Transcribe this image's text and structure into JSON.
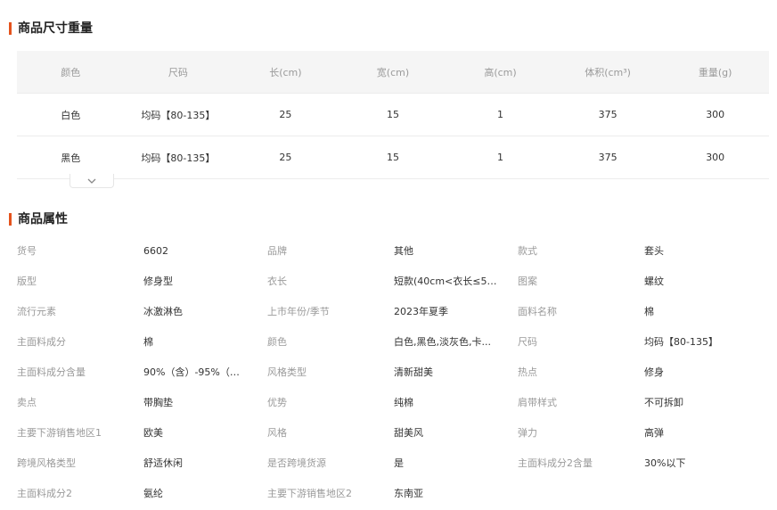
{
  "size_section": {
    "title": "商品尺寸重量",
    "headers": [
      "颜色",
      "尺码",
      "长(cm)",
      "宽(cm)",
      "高(cm)",
      "体积(cm³)",
      "重量(g)"
    ],
    "rows": [
      [
        "白色",
        "均码【80-135】",
        "25",
        "15",
        "1",
        "375",
        "300"
      ],
      [
        "黑色",
        "均码【80-135】",
        "25",
        "15",
        "1",
        "375",
        "300"
      ]
    ],
    "expand_icon": "chevron-down-icon"
  },
  "attr_section": {
    "title": "商品属性",
    "items": [
      {
        "label": "货号",
        "value": "6602"
      },
      {
        "label": "品牌",
        "value": "其他"
      },
      {
        "label": "款式",
        "value": "套头"
      },
      {
        "label": "版型",
        "value": "修身型"
      },
      {
        "label": "衣长",
        "value": "短款(40cm<衣长≤50..."
      },
      {
        "label": "图案",
        "value": "螺纹"
      },
      {
        "label": "流行元素",
        "value": "冰激淋色"
      },
      {
        "label": "上市年份/季节",
        "value": "2023年夏季"
      },
      {
        "label": "面料名称",
        "value": "棉"
      },
      {
        "label": "主面料成分",
        "value": "棉"
      },
      {
        "label": "颜色",
        "value": "白色,黑色,淡灰色,卡..."
      },
      {
        "label": "尺码",
        "value": "均码【80-135】"
      },
      {
        "label": "主面料成分含量",
        "value": "90%（含）-95%（不..."
      },
      {
        "label": "风格类型",
        "value": "清新甜美"
      },
      {
        "label": "热点",
        "value": "修身"
      },
      {
        "label": "卖点",
        "value": "带胸垫"
      },
      {
        "label": "优势",
        "value": "纯棉"
      },
      {
        "label": "肩带样式",
        "value": "不可拆卸"
      },
      {
        "label": "主要下游销售地区1",
        "value": "欧美"
      },
      {
        "label": "风格",
        "value": "甜美风"
      },
      {
        "label": "弹力",
        "value": "高弹"
      },
      {
        "label": "跨境风格类型",
        "value": "舒适休闲"
      },
      {
        "label": "是否跨境货源",
        "value": "是"
      },
      {
        "label": "主面料成分2含量",
        "value": "30%以下"
      },
      {
        "label": "主面料成分2",
        "value": "氨纶"
      },
      {
        "label": "主要下游销售地区2",
        "value": "东南亚"
      }
    ]
  },
  "colors": {
    "accent": "#e4531d"
  }
}
